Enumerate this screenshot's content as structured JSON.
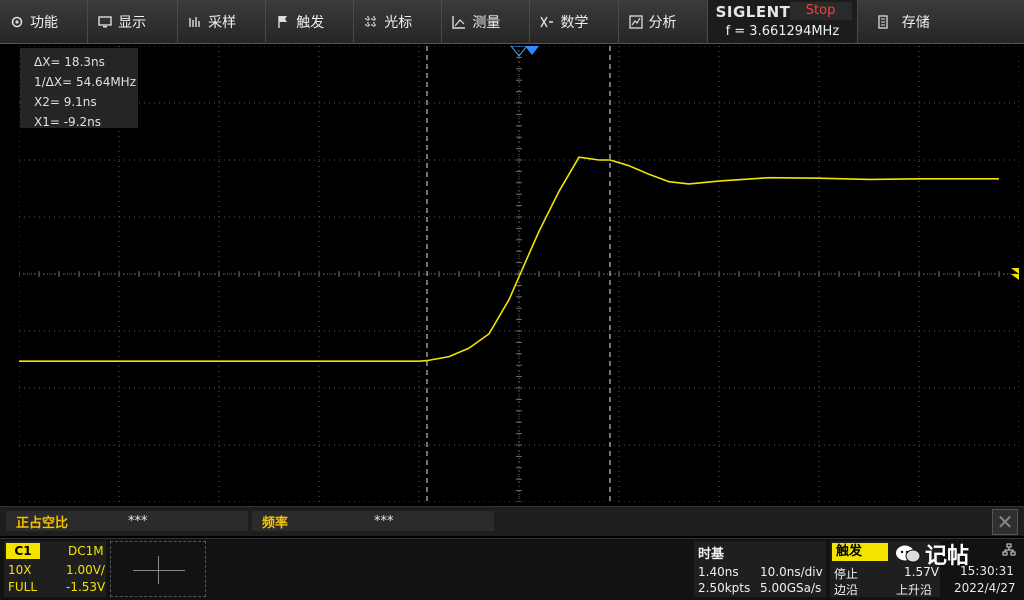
{
  "menu": {
    "items": [
      {
        "label": "功能",
        "icon": "gear-icon"
      },
      {
        "label": "显示",
        "icon": "display-icon"
      },
      {
        "label": "采样",
        "icon": "acquire-icon"
      },
      {
        "label": "触发",
        "icon": "flag-icon"
      },
      {
        "label": "光标",
        "icon": "cursor-icon"
      },
      {
        "label": "测量",
        "icon": "measure-icon"
      },
      {
        "label": "数学",
        "icon": "math-icon"
      },
      {
        "label": "分析",
        "icon": "analysis-icon"
      }
    ],
    "brand": "SIGLENT",
    "run_state": "Stop",
    "frequency": "f = 3.661294MHz",
    "save_label": "存储",
    "save_icon": "document-icon"
  },
  "cursor_readout": {
    "delta_x": "ΔX= 18.3ns",
    "inv_delta_x": "1/ΔX= 54.64MHz",
    "x2": "X2= 9.1ns",
    "x1": "X1= -9.2ns"
  },
  "measurements": [
    {
      "label": "正占空比",
      "value": "***"
    },
    {
      "label": "频率",
      "value": "***"
    }
  ],
  "channel1": {
    "tag": "C1",
    "coupling": "DC1M",
    "probe": "10X",
    "scale": "1.00V/",
    "bandwidth": "FULL",
    "offset": "-1.53V"
  },
  "timebase": {
    "title": "时基",
    "delay": "1.40ns",
    "scale": "10.0ns/div",
    "memory": "2.50kpts",
    "sample_rate": "5.00GSa/s"
  },
  "trigger": {
    "title": "触发",
    "state": "停止",
    "level": "1.57V",
    "type": "边沿",
    "slope": "上升沿"
  },
  "clock": {
    "time": "15:30:31",
    "date": "2022/4/27"
  },
  "watermark": "记帖",
  "colors": {
    "trace": "#f2e400",
    "label_yellow": "#f2c200",
    "stop_red": "#ff3b3b",
    "grid": "#5a5a5a"
  },
  "chart_data": {
    "type": "line",
    "title": "",
    "xlabel": "",
    "ylabel": "",
    "x_unit": "ns",
    "xlim": [
      -50,
      50
    ],
    "ylim": [
      -4,
      4
    ],
    "grid": true,
    "series": [
      {
        "x": [
          -50,
          -40,
          -20,
          -10,
          -9.2,
          -7,
          -5,
          -3,
          -1,
          0,
          2,
          4,
          6,
          8,
          9.1,
          11,
          13,
          15,
          17,
          20,
          25,
          30,
          35,
          40,
          45,
          48
        ],
        "values": [
          -1.53,
          -1.53,
          -1.53,
          -1.53,
          -1.52,
          -1.45,
          -1.3,
          -1.05,
          -0.45,
          -0.05,
          0.75,
          1.45,
          2.05,
          2.0,
          2.0,
          1.9,
          1.75,
          1.62,
          1.58,
          1.63,
          1.69,
          1.68,
          1.66,
          1.67,
          1.67,
          1.67
        ]
      }
    ]
  }
}
